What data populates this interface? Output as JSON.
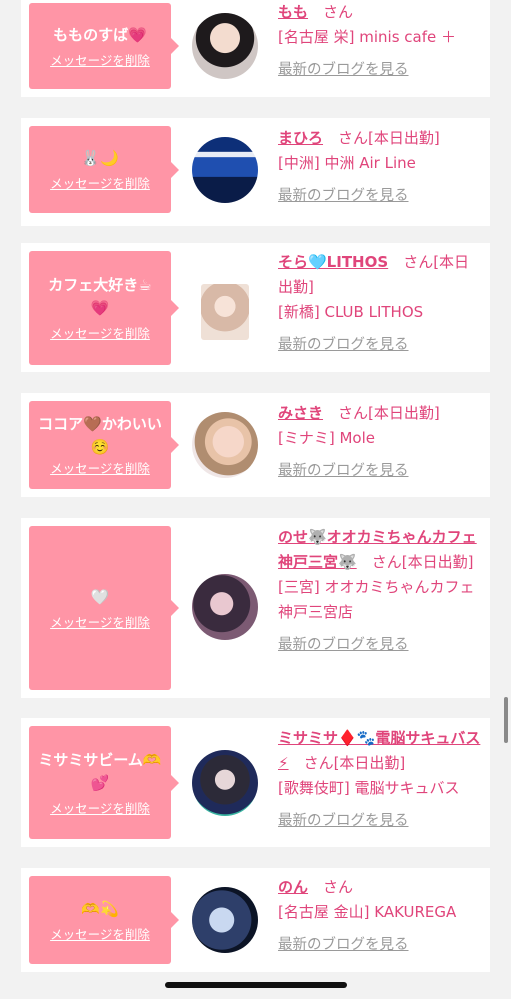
{
  "delete_label": "メッセージを削除",
  "san": "さん",
  "blog_label": "最新のブログを見る",
  "cards": [
    {
      "message": "もものすば💗",
      "name": "もも",
      "status": "",
      "shop": "[名古屋 栄] minis cafe ＋"
    },
    {
      "message": "🐰🌙",
      "name": "まひろ",
      "status": "[本日出勤]",
      "shop": "[中洲] 中洲 Air Line"
    },
    {
      "message": "カフェ大好き☕💗",
      "name": "そら🩵LITHOS",
      "status": "[本日出勤]",
      "shop": "[新橋] CLUB LITHOS"
    },
    {
      "message": "ココア🤎かわいい☺️",
      "name": "みさき",
      "status": "[本日出勤]",
      "shop": "[ミナミ] Mole"
    },
    {
      "message": "🤍",
      "name": "のせ🐺オオカミちゃんカフェ神戸三宮🐺",
      "status": "[本日出勤]",
      "shop": "[三宮] オオカミちゃんカフェ神戸三宮店"
    },
    {
      "message": "ミサミサビーム🫶💕",
      "name": "ミサミサ♦️🐾電脳サキュバス⚡",
      "status": "[本日出勤]",
      "shop": "[歌舞伎町] 電脳サキュバス"
    },
    {
      "message": "🫶💫",
      "name": "のん",
      "status": "",
      "shop": "[名古屋 金山] KAKUREGA"
    }
  ],
  "colors": {
    "bubble": "#ff95a6",
    "name": "#e0457b",
    "blog": "#9a9a9a"
  }
}
